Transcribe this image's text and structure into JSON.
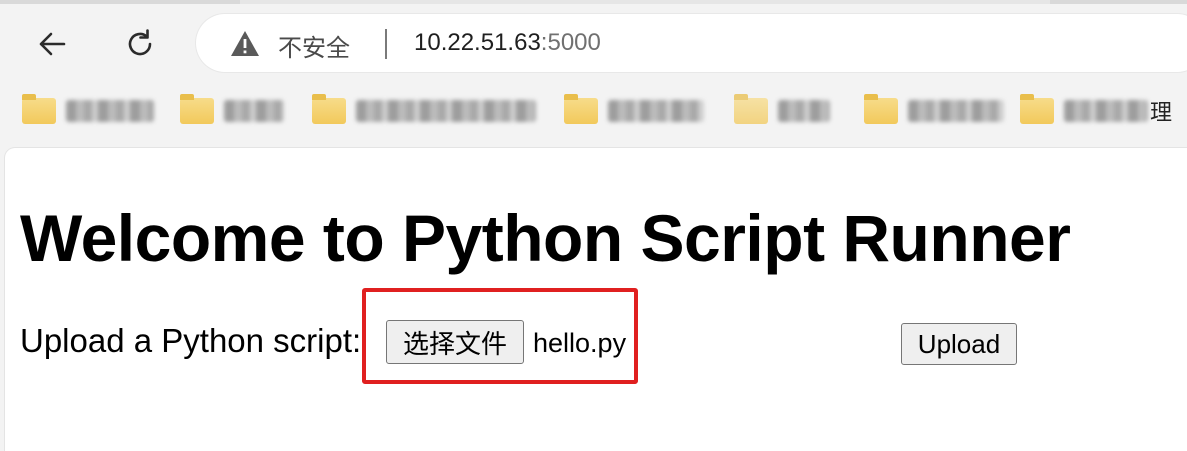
{
  "browser": {
    "omnibox": {
      "security_status": "不安全",
      "url_host": "10.22.51.63",
      "url_port": ":5000"
    },
    "icons": {
      "back": "arrow-left-icon",
      "reload": "reload-icon",
      "security": "warning-triangle-icon",
      "bookmark_folder": "folder-icon"
    },
    "bookmarks": [
      {
        "label": "",
        "redacted": true
      },
      {
        "label": "",
        "redacted": true
      },
      {
        "label": "",
        "redacted": true
      },
      {
        "label": "",
        "redacted": true
      },
      {
        "label": "",
        "redacted": true
      },
      {
        "label": "",
        "redacted": true
      },
      {
        "label": "理",
        "redacted": true
      }
    ]
  },
  "page": {
    "title": "Welcome to Python Script Runner",
    "upload_label": "Upload a Python script:",
    "file_button_label": "选择文件",
    "selected_file": "hello.py",
    "upload_button_label": "Upload"
  },
  "colors": {
    "highlight": "#e02020",
    "folder": "#f2c95b"
  }
}
